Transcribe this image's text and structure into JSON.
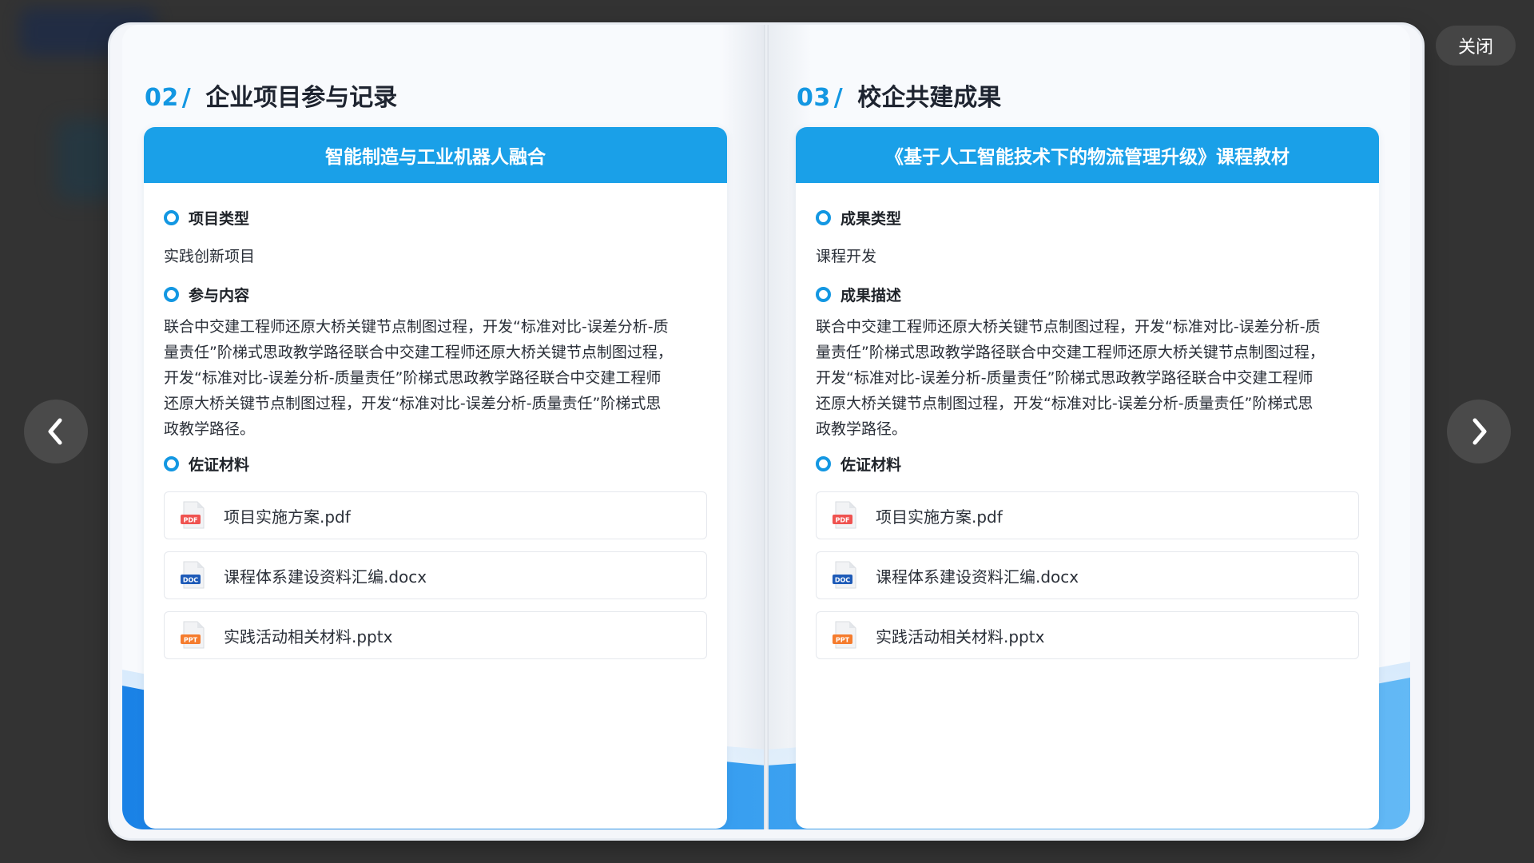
{
  "close_label": "关闭",
  "colors": {
    "accent": "#1397e2",
    "card_header": "#1aa0e8",
    "backdrop": "#333333"
  },
  "nav": {
    "prev_icon": "chevron-left-icon",
    "next_icon": "chevron-right-icon"
  },
  "left_page": {
    "section_number": "02",
    "section_slash": "/",
    "section_title": "企业项目参与记录",
    "card_title": "智能制造与工业机器人融合",
    "type_label": "项目类型",
    "type_value": "实践创新项目",
    "content_label": "参与内容",
    "content_lines": [
      "联合中交建工程师还原大桥关键节点制图过程，开发“标准对比-误差分析-质",
      "量责任”阶梯式思政教学路径联合中交建工程师还原大桥关键节点制图过程，",
      "开发“标准对比-误差分析-质量责任”阶梯式思政教学路径联合中交建工程师",
      "还原大桥关键节点制图过程，开发“标准对比-误差分析-质量责任”阶梯式思",
      "政教学路径。"
    ],
    "evidence_label": "佐证材料",
    "files": [
      {
        "name": "项目实施方案.pdf",
        "icon": "pdf-file-icon",
        "badge": "PDF"
      },
      {
        "name": "课程体系建设资料汇编.docx",
        "icon": "doc-file-icon",
        "badge": "DOC"
      },
      {
        "name": "实践活动相关材料.pptx",
        "icon": "ppt-file-icon",
        "badge": "PPT"
      }
    ]
  },
  "right_page": {
    "section_number": "03",
    "section_slash": "/",
    "section_title": "校企共建成果",
    "card_title": "《基于人工智能技术下的物流管理升级》课程教材",
    "type_label": "成果类型",
    "type_value": "课程开发",
    "content_label": "成果描述",
    "content_lines": [
      "联合中交建工程师还原大桥关键节点制图过程，开发“标准对比-误差分析-质",
      "量责任”阶梯式思政教学路径联合中交建工程师还原大桥关键节点制图过程，",
      "开发“标准对比-误差分析-质量责任”阶梯式思政教学路径联合中交建工程师",
      "还原大桥关键节点制图过程，开发“标准对比-误差分析-质量责任”阶梯式思",
      "政教学路径。"
    ],
    "evidence_label": "佐证材料",
    "files": [
      {
        "name": "项目实施方案.pdf",
        "icon": "pdf-file-icon",
        "badge": "PDF"
      },
      {
        "name": "课程体系建设资料汇编.docx",
        "icon": "doc-file-icon",
        "badge": "DOC"
      },
      {
        "name": "实践活动相关材料.pptx",
        "icon": "ppt-file-icon",
        "badge": "PPT"
      }
    ]
  }
}
